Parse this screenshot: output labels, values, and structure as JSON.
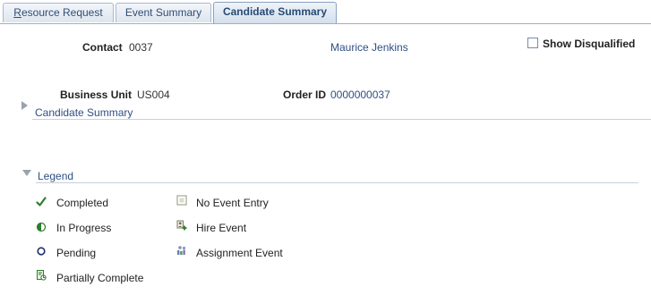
{
  "tabs": [
    {
      "label": "Resource Request",
      "active": false
    },
    {
      "label": "Event Summary",
      "active": false
    },
    {
      "label": "Candidate Summary",
      "active": true
    }
  ],
  "header": {
    "contact_label": "Contact",
    "contact_value": "0037",
    "contact_name": "Maurice Jenkins",
    "show_disqualified_label": "Show Disqualified",
    "show_disqualified_checked": false,
    "business_unit_label": "Business Unit",
    "business_unit_value": "US004",
    "order_id_label": "Order ID",
    "order_id_value": "0000000037"
  },
  "sections": {
    "candidate_summary": "Candidate Summary",
    "legend": "Legend"
  },
  "legend": {
    "items": [
      {
        "label": "Completed",
        "icon": "check-icon"
      },
      {
        "label": "In Progress",
        "icon": "half-circle-icon"
      },
      {
        "label": "Pending",
        "icon": "open-circle-icon"
      },
      {
        "label": "Partially Complete",
        "icon": "partial-doc-icon"
      },
      {
        "label": "No Event Entry",
        "icon": "empty-square-icon"
      },
      {
        "label": "Hire Event",
        "icon": "hire-event-icon"
      },
      {
        "label": "Assignment Event",
        "icon": "assignment-event-icon"
      }
    ]
  },
  "colors": {
    "link": "#2e4f84",
    "check": "#2d7d2d",
    "tab_text": "#2f4d76"
  }
}
